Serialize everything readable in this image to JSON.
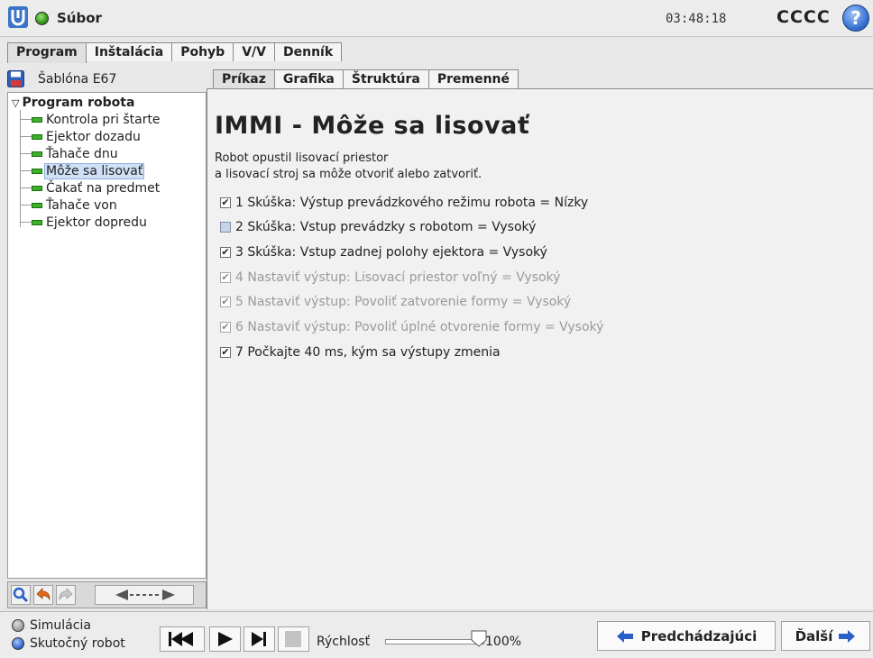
{
  "header": {
    "file_menu": "Súbor",
    "clock": "03:48:18",
    "robot_name": "CCCC",
    "help": "?"
  },
  "main_tabs": [
    {
      "label": "Program",
      "active": true
    },
    {
      "label": "Inštalácia",
      "active": false
    },
    {
      "label": "Pohyb",
      "active": false
    },
    {
      "label": "V/V",
      "active": false
    },
    {
      "label": "Denník",
      "active": false
    }
  ],
  "sidebar": {
    "template_label": "Šablóna E67",
    "tree_root": "Program robota",
    "tree_items": [
      {
        "label": "Kontrola pri štarte",
        "selected": false
      },
      {
        "label": "Ejektor dozadu",
        "selected": false
      },
      {
        "label": "Ťahače dnu",
        "selected": false
      },
      {
        "label": "Môže sa lisovať",
        "selected": true
      },
      {
        "label": "Čakať na predmet",
        "selected": false
      },
      {
        "label": "Ťahače von",
        "selected": false
      },
      {
        "label": "Ejektor dopredu",
        "selected": false
      }
    ]
  },
  "content_tabs": [
    {
      "label": "Príkaz",
      "active": true
    },
    {
      "label": "Grafika",
      "active": false
    },
    {
      "label": "Štruktúra",
      "active": false
    },
    {
      "label": "Premenné",
      "active": false
    }
  ],
  "content": {
    "title": "IMMI - Môže sa lisovať",
    "description_line1": "Robot opustil lisovací priestor",
    "description_line2": "a lisovací stroj sa môže otvoriť alebo zatvoriť.",
    "checks": [
      {
        "label": "1 Skúška: Výstup prevádzkového režimu robota = Nízky",
        "checked": true,
        "enabled": true
      },
      {
        "label": "2 Skúška: Vstup prevádzky s robotom = Vysoký",
        "checked": false,
        "enabled": true
      },
      {
        "label": "3 Skúška: Vstup zadnej polohy ejektora = Vysoký",
        "checked": true,
        "enabled": true
      },
      {
        "label": "4 Nastaviť výstup: Lisovací priestor voľný = Vysoký",
        "checked": true,
        "enabled": false
      },
      {
        "label": "5 Nastaviť výstup: Povoliť zatvorenie formy = Vysoký",
        "checked": true,
        "enabled": false
      },
      {
        "label": "6 Nastaviť výstup: Povoliť úplné otvorenie formy = Vysoký",
        "checked": true,
        "enabled": false
      },
      {
        "label": "7 Počkajte 40 ms, kým sa výstupy zmenia",
        "checked": true,
        "enabled": true
      }
    ]
  },
  "footer": {
    "simulation_label": "Simulácia",
    "real_robot_label": "Skutočný robot",
    "real_robot_selected": true,
    "speed_label": "Rýchlosť",
    "speed_value": "100%",
    "speed_fraction": 1.0,
    "prev_button": "Predchádzajúci",
    "next_button": "Ďalší"
  },
  "colors": {
    "accent_blue": "#2a5fc8",
    "status_green": "#3a9e1e",
    "node_green": "#3cb02a",
    "selection": "#cfe0f7"
  }
}
